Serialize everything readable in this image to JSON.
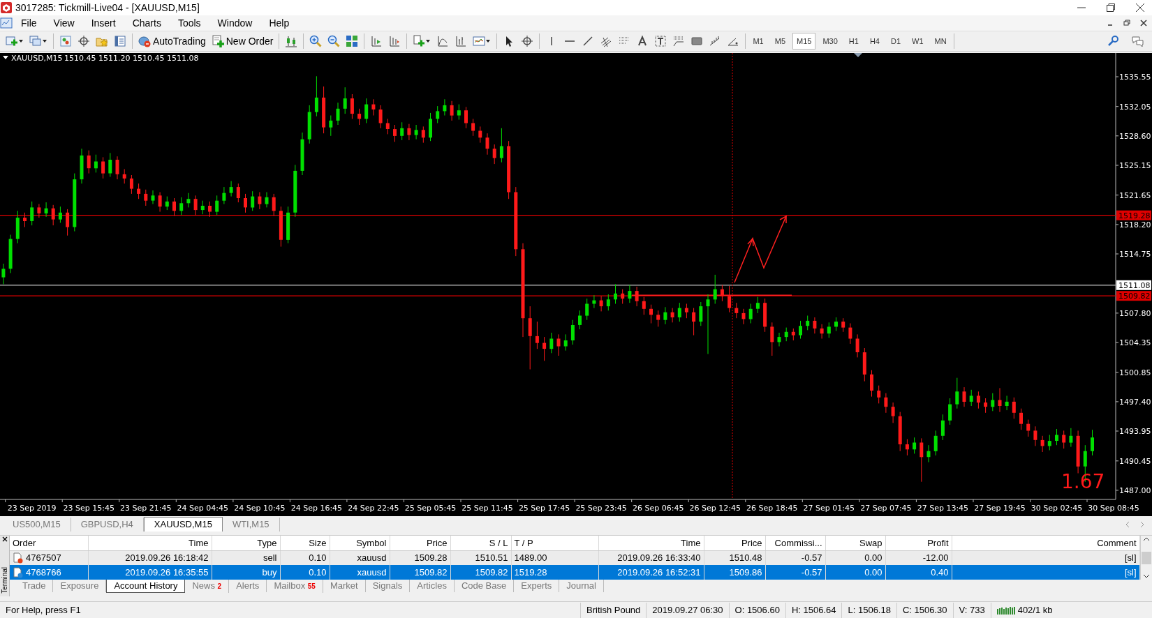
{
  "window": {
    "title": "3017285: Tickmill-Live04 - [XAUUSD,M15]"
  },
  "menu": [
    "File",
    "View",
    "Insert",
    "Charts",
    "Tools",
    "Window",
    "Help"
  ],
  "toolbar": {
    "buttons": [
      {
        "label": "AutoTrading",
        "kind": "autotrading"
      },
      {
        "label": "New Order",
        "kind": "new-order"
      }
    ],
    "timeframes": [
      {
        "label": "M1",
        "selected": false
      },
      {
        "label": "M5",
        "selected": false
      },
      {
        "label": "M15",
        "selected": true
      },
      {
        "label": "M30",
        "selected": false
      },
      {
        "label": "H1",
        "selected": false
      },
      {
        "label": "H4",
        "selected": false
      },
      {
        "label": "D1",
        "selected": false
      },
      {
        "label": "W1",
        "selected": false
      },
      {
        "label": "MN",
        "selected": false
      }
    ]
  },
  "chart": {
    "symbol": "XAUUSD,M15",
    "ohlc_readout": "1510.45 1511.20 1510.45 1511.08",
    "overlay_value": "1.67",
    "chart_data": {
      "type": "candlestick",
      "categories": [
        null,
        null,
        null,
        null,
        "23 Sep 2019",
        null,
        null,
        null,
        null,
        null,
        null,
        null,
        "23 Sep 15:45",
        null,
        null,
        null,
        null,
        null,
        null,
        null,
        "23 Sep 21:45",
        null,
        null,
        null,
        null,
        null,
        null,
        null,
        "24 Sep 04:45",
        null,
        null,
        null,
        null,
        null,
        null,
        null,
        "24 Sep 10:45",
        null,
        null,
        null,
        null,
        null,
        null,
        null,
        "24 Sep 16:45",
        null,
        null,
        null,
        null,
        null,
        null,
        null,
        "24 Sep 22:45",
        null,
        null,
        null,
        null,
        null,
        null,
        null,
        "25 Sep 05:45",
        null,
        null,
        null,
        null,
        null,
        null,
        null,
        "25 Sep 11:45",
        null,
        null,
        null,
        null,
        null,
        null,
        null,
        "25 Sep 17:45",
        null,
        null,
        null,
        null,
        null,
        null,
        null,
        "25 Sep 23:45",
        null,
        null,
        null,
        null,
        null,
        null,
        null,
        "26 Sep 06:45",
        null,
        null,
        null,
        null,
        null,
        null,
        null,
        "26 Sep 12:45",
        null,
        null,
        null,
        null,
        null,
        null,
        null,
        "26 Sep 18:45",
        null,
        null,
        null,
        null,
        null,
        null,
        null,
        "27 Sep 01:45",
        null,
        null,
        null,
        null,
        null,
        null,
        null,
        "27 Sep 07:45",
        null,
        null,
        null,
        null,
        null,
        null,
        null,
        "27 Sep 13:45",
        null,
        null,
        null,
        null,
        null,
        null,
        null,
        "27 Sep 19:45",
        null,
        null,
        null,
        null,
        null,
        null,
        null,
        "30 Sep 02:45",
        null,
        null,
        null,
        null,
        null,
        null,
        null,
        "30 Sep 08:45"
      ],
      "ref_lines": [
        {
          "axis": "y",
          "value": 1519.28,
          "label": "1519.28",
          "color": "#e00000"
        },
        {
          "axis": "y",
          "value": 1511.08,
          "label": "1511.08",
          "color": "#c0c0c0"
        },
        {
          "axis": "y",
          "value": 1509.82,
          "label": "1509.82",
          "color": "#e00000"
        }
      ],
      "ohlc": [
        [
          1512.0,
          1513.6,
          1511.2,
          1513.0
        ],
        [
          1513.0,
          1517.0,
          1512.5,
          1516.5
        ],
        [
          1516.5,
          1519.8,
          1516.0,
          1519.0
        ],
        [
          1519.0,
          1519.6,
          1517.9,
          1518.6
        ],
        [
          1518.6,
          1520.9,
          1518.1,
          1520.2
        ],
        [
          1520.2,
          1520.6,
          1519.0,
          1519.5
        ],
        [
          1519.5,
          1520.8,
          1519.1,
          1520.1
        ],
        [
          1520.1,
          1520.5,
          1518.1,
          1518.8
        ],
        [
          1518.8,
          1520.3,
          1518.4,
          1519.6
        ],
        [
          1519.6,
          1520.0,
          1516.9,
          1517.9
        ],
        [
          1517.9,
          1524.2,
          1517.4,
          1523.5
        ],
        [
          1523.5,
          1527.1,
          1523.0,
          1526.3
        ],
        [
          1526.3,
          1526.9,
          1524.2,
          1524.8
        ],
        [
          1524.8,
          1526.4,
          1524.3,
          1525.6
        ],
        [
          1525.6,
          1526.1,
          1523.6,
          1524.2
        ],
        [
          1524.2,
          1526.6,
          1523.8,
          1525.8
        ],
        [
          1525.8,
          1526.2,
          1523.5,
          1524.1
        ],
        [
          1524.1,
          1524.7,
          1523.0,
          1523.6
        ],
        [
          1523.6,
          1524.0,
          1521.8,
          1522.4
        ],
        [
          1522.4,
          1523.0,
          1521.2,
          1521.8
        ],
        [
          1521.8,
          1522.3,
          1520.4,
          1521.0
        ],
        [
          1521.0,
          1522.2,
          1520.6,
          1521.6
        ],
        [
          1521.6,
          1522.0,
          1519.7,
          1520.3
        ],
        [
          1520.3,
          1521.5,
          1519.9,
          1520.9
        ],
        [
          1520.9,
          1521.3,
          1519.2,
          1519.8
        ],
        [
          1519.8,
          1521.4,
          1519.3,
          1520.7
        ],
        [
          1520.7,
          1521.9,
          1520.2,
          1521.2
        ],
        [
          1521.2,
          1521.6,
          1519.3,
          1519.9
        ],
        [
          1519.9,
          1521.0,
          1519.4,
          1520.4
        ],
        [
          1520.4,
          1520.9,
          1519.1,
          1519.7
        ],
        [
          1519.7,
          1521.6,
          1519.3,
          1521.0
        ],
        [
          1521.0,
          1522.6,
          1520.6,
          1521.9
        ],
        [
          1521.9,
          1523.3,
          1521.5,
          1522.6
        ],
        [
          1522.6,
          1523.0,
          1520.8,
          1521.3
        ],
        [
          1521.3,
          1521.8,
          1519.6,
          1520.2
        ],
        [
          1520.2,
          1522.1,
          1519.8,
          1521.5
        ],
        [
          1521.5,
          1522.0,
          1520.0,
          1520.6
        ],
        [
          1520.6,
          1522.0,
          1520.2,
          1521.4
        ],
        [
          1521.4,
          1521.8,
          1519.2,
          1519.8
        ],
        [
          1519.8,
          1520.3,
          1515.6,
          1516.4
        ],
        [
          1516.4,
          1520.3,
          1516.0,
          1519.6
        ],
        [
          1519.6,
          1525.2,
          1519.1,
          1524.5
        ],
        [
          1524.5,
          1529.0,
          1524.0,
          1528.2
        ],
        [
          1528.2,
          1532.2,
          1527.7,
          1531.4
        ],
        [
          1531.4,
          1535.6,
          1530.9,
          1533.1
        ],
        [
          1533.1,
          1534.4,
          1528.9,
          1529.6
        ],
        [
          1529.6,
          1531.0,
          1528.6,
          1530.4
        ],
        [
          1530.4,
          1532.5,
          1529.9,
          1531.8
        ],
        [
          1531.8,
          1534.3,
          1531.2,
          1533.0
        ],
        [
          1533.0,
          1533.5,
          1530.6,
          1531.2
        ],
        [
          1531.2,
          1531.8,
          1529.9,
          1530.6
        ],
        [
          1530.6,
          1533.0,
          1530.1,
          1532.3
        ],
        [
          1532.3,
          1532.9,
          1531.0,
          1531.7
        ],
        [
          1531.7,
          1532.2,
          1529.5,
          1530.1
        ],
        [
          1530.1,
          1530.6,
          1528.8,
          1529.4
        ],
        [
          1529.4,
          1529.9,
          1527.9,
          1528.6
        ],
        [
          1528.6,
          1530.2,
          1528.1,
          1529.5
        ],
        [
          1529.5,
          1530.0,
          1528.1,
          1528.7
        ],
        [
          1528.7,
          1529.9,
          1528.2,
          1529.3
        ],
        [
          1529.3,
          1529.7,
          1527.8,
          1528.4
        ],
        [
          1528.4,
          1531.3,
          1528.0,
          1530.6
        ],
        [
          1530.6,
          1532.1,
          1530.1,
          1531.5
        ],
        [
          1531.5,
          1532.9,
          1531.0,
          1532.2
        ],
        [
          1532.2,
          1532.7,
          1530.4,
          1531.0
        ],
        [
          1531.0,
          1532.3,
          1530.5,
          1531.6
        ],
        [
          1531.6,
          1532.0,
          1529.5,
          1530.1
        ],
        [
          1530.1,
          1530.6,
          1528.6,
          1529.2
        ],
        [
          1529.2,
          1529.7,
          1527.8,
          1528.4
        ],
        [
          1528.4,
          1528.9,
          1526.4,
          1527.1
        ],
        [
          1527.1,
          1527.6,
          1525.3,
          1526.0
        ],
        [
          1526.0,
          1529.5,
          1525.5,
          1527.4
        ],
        [
          1527.4,
          1528.0,
          1521.2,
          1522.0
        ],
        [
          1522.0,
          1522.6,
          1514.5,
          1515.3
        ],
        [
          1515.3,
          1516.0,
          1505.0,
          1507.2
        ],
        [
          1507.2,
          1508.6,
          1501.2,
          1505.1
        ],
        [
          1505.1,
          1506.8,
          1503.6,
          1504.3
        ],
        [
          1504.3,
          1505.0,
          1502.2,
          1503.6
        ],
        [
          1503.6,
          1505.5,
          1503.1,
          1504.8
        ],
        [
          1504.8,
          1505.3,
          1502.8,
          1503.9
        ],
        [
          1503.9,
          1505.3,
          1503.4,
          1504.6
        ],
        [
          1504.6,
          1507.0,
          1504.1,
          1506.4
        ],
        [
          1506.4,
          1508.1,
          1505.9,
          1507.5
        ],
        [
          1507.5,
          1509.5,
          1507.0,
          1508.9
        ],
        [
          1508.9,
          1509.9,
          1508.4,
          1509.3
        ],
        [
          1509.3,
          1509.8,
          1508.0,
          1508.6
        ],
        [
          1508.6,
          1510.0,
          1508.1,
          1509.4
        ],
        [
          1509.4,
          1511.2,
          1508.9,
          1510.1
        ],
        [
          1510.1,
          1510.6,
          1508.9,
          1509.5
        ],
        [
          1509.5,
          1511.1,
          1509.0,
          1510.4
        ],
        [
          1510.4,
          1510.9,
          1508.6,
          1509.2
        ],
        [
          1509.2,
          1509.7,
          1507.6,
          1508.3
        ],
        [
          1508.3,
          1508.8,
          1506.6,
          1507.6
        ],
        [
          1507.6,
          1508.1,
          1506.2,
          1507.0
        ],
        [
          1507.0,
          1508.5,
          1506.5,
          1507.9
        ],
        [
          1507.9,
          1508.4,
          1506.7,
          1507.3
        ],
        [
          1507.3,
          1509.0,
          1506.8,
          1508.4
        ],
        [
          1508.4,
          1508.9,
          1507.2,
          1507.9
        ],
        [
          1507.9,
          1508.4,
          1505.2,
          1506.8
        ],
        [
          1506.8,
          1509.1,
          1506.3,
          1508.6
        ],
        [
          1508.6,
          1510.0,
          1503.0,
          1509.4
        ],
        [
          1509.4,
          1512.3,
          1508.9,
          1510.6
        ],
        [
          1510.6,
          1511.1,
          1509.2,
          1509.8
        ],
        [
          1509.8,
          1511.0,
          1507.9,
          1508.4
        ],
        [
          1508.4,
          1509.0,
          1507.2,
          1507.8
        ],
        [
          1507.8,
          1508.3,
          1506.5,
          1507.1
        ],
        [
          1507.1,
          1508.9,
          1506.6,
          1508.3
        ],
        [
          1508.3,
          1509.7,
          1507.8,
          1509.0
        ],
        [
          1509.0,
          1509.5,
          1505.6,
          1506.2
        ],
        [
          1506.2,
          1506.7,
          1502.8,
          1504.4
        ],
        [
          1504.4,
          1505.5,
          1503.9,
          1505.0
        ],
        [
          1505.0,
          1506.1,
          1504.5,
          1505.6
        ],
        [
          1505.6,
          1506.0,
          1504.6,
          1505.2
        ],
        [
          1505.2,
          1506.9,
          1504.8,
          1506.3
        ],
        [
          1506.3,
          1507.5,
          1505.8,
          1506.9
        ],
        [
          1506.9,
          1507.3,
          1505.4,
          1506.0
        ],
        [
          1506.0,
          1506.5,
          1504.8,
          1505.4
        ],
        [
          1505.4,
          1506.7,
          1504.9,
          1506.2
        ],
        [
          1506.2,
          1507.3,
          1505.7,
          1506.8
        ],
        [
          1506.8,
          1507.2,
          1505.6,
          1506.1
        ],
        [
          1506.1,
          1506.6,
          1504.2,
          1504.8
        ],
        [
          1504.8,
          1505.3,
          1502.6,
          1503.2
        ],
        [
          1503.2,
          1503.7,
          1499.8,
          1500.6
        ],
        [
          1500.6,
          1501.1,
          1498.0,
          1498.7
        ],
        [
          1498.7,
          1499.3,
          1497.2,
          1497.9
        ],
        [
          1497.9,
          1498.4,
          1496.1,
          1496.8
        ],
        [
          1496.8,
          1497.3,
          1494.9,
          1495.7
        ],
        [
          1495.7,
          1496.2,
          1491.6,
          1492.4
        ],
        [
          1492.4,
          1493.0,
          1491.1,
          1491.8
        ],
        [
          1491.8,
          1493.2,
          1491.3,
          1492.6
        ],
        [
          1492.6,
          1493.1,
          1488.0,
          1490.9
        ],
        [
          1490.9,
          1492.3,
          1490.3,
          1491.6
        ],
        [
          1491.6,
          1494.0,
          1491.1,
          1493.4
        ],
        [
          1493.4,
          1495.9,
          1492.9,
          1495.2
        ],
        [
          1495.2,
          1497.8,
          1494.7,
          1497.1
        ],
        [
          1497.1,
          1500.2,
          1496.6,
          1498.6
        ],
        [
          1498.6,
          1499.1,
          1496.8,
          1497.4
        ],
        [
          1497.4,
          1498.8,
          1496.9,
          1498.1
        ],
        [
          1498.1,
          1498.6,
          1496.6,
          1497.3
        ],
        [
          1497.3,
          1497.8,
          1496.1,
          1496.8
        ],
        [
          1496.8,
          1498.4,
          1496.3,
          1497.6
        ],
        [
          1497.6,
          1499.0,
          1496.2,
          1496.9
        ],
        [
          1496.9,
          1498.1,
          1496.4,
          1497.4
        ],
        [
          1497.4,
          1497.9,
          1495.4,
          1496.1
        ],
        [
          1496.1,
          1496.6,
          1494.1,
          1494.8
        ],
        [
          1494.8,
          1495.3,
          1493.3,
          1494.0
        ],
        [
          1494.0,
          1494.5,
          1492.2,
          1492.9
        ],
        [
          1492.9,
          1493.4,
          1491.5,
          1492.2
        ],
        [
          1492.2,
          1493.5,
          1491.7,
          1492.8
        ],
        [
          1492.8,
          1494.2,
          1492.3,
          1493.5
        ],
        [
          1493.5,
          1494.0,
          1491.9,
          1492.6
        ],
        [
          1492.6,
          1494.3,
          1492.1,
          1493.4
        ],
        [
          1493.4,
          1494.0,
          1489.0,
          1489.8
        ],
        [
          1489.8,
          1492.3,
          1488.0,
          1491.6
        ],
        [
          1491.6,
          1494.1,
          1491.1,
          1493.2
        ],
        null,
        null,
        null
      ],
      "ylim": [
        1485.93,
        1538.33
      ],
      "yticks": [
        {
          "value": 1535.55,
          "label": "1535.55"
        },
        {
          "value": 1532.05,
          "label": "1532.05"
        },
        {
          "value": 1528.6,
          "label": "1528.60"
        },
        {
          "value": 1525.15,
          "label": "1525.15"
        },
        {
          "value": 1521.65,
          "label": "1521.65"
        },
        {
          "value": 1518.2,
          "label": "1518.20"
        },
        {
          "value": 1514.75,
          "label": "1514.75"
        },
        {
          "value": 1507.8,
          "label": "1507.80"
        },
        {
          "value": 1504.35,
          "label": "1504.35"
        },
        {
          "value": 1500.85,
          "label": "1500.85"
        },
        {
          "value": 1497.4,
          "label": "1497.40"
        },
        {
          "value": 1493.95,
          "label": "1493.95"
        },
        {
          "value": 1490.45,
          "label": "1490.45"
        },
        {
          "value": 1487,
          "label": "1487.00"
        }
      ]
    }
  },
  "chart_tabs": [
    {
      "label": "US500,M15",
      "selected": false
    },
    {
      "label": "GBPUSD,H4",
      "selected": false
    },
    {
      "label": "XAUUSD,M15",
      "selected": true
    },
    {
      "label": "WTI,M15",
      "selected": false
    }
  ],
  "terminal": {
    "title": "Terminal",
    "columns": [
      "Order",
      "Time",
      "Type",
      "Size",
      "Symbol",
      "Price",
      "S / L",
      "T / P",
      "Time",
      "Price",
      "Commissi...",
      "Swap",
      "Profit",
      "Comment"
    ],
    "rows": [
      {
        "kind": "sell",
        "selected": false,
        "cells": [
          "4767507",
          "2019.09.26 16:18:42",
          "sell",
          "0.10",
          "xauusd",
          "1509.28",
          "1510.51",
          "1489.00",
          "2019.09.26 16:33:40",
          "1510.48",
          "-0.57",
          "0.00",
          "-12.00",
          "[sl]"
        ]
      },
      {
        "kind": "buy",
        "selected": true,
        "cells": [
          "4768766",
          "2019.09.26 16:35:55",
          "buy",
          "0.10",
          "xauusd",
          "1509.82",
          "1509.82",
          "1519.28",
          "2019.09.26 16:52:31",
          "1509.86",
          "-0.57",
          "0.00",
          "0.40",
          "[sl]"
        ]
      }
    ],
    "tabs": [
      {
        "label": "Trade",
        "selected": false
      },
      {
        "label": "Exposure",
        "selected": false
      },
      {
        "label": "Account History",
        "selected": true
      },
      {
        "label": "News",
        "count": "2",
        "selected": false
      },
      {
        "label": "Alerts",
        "selected": false
      },
      {
        "label": "Mailbox",
        "count": "55",
        "selected": false
      },
      {
        "label": "Market",
        "selected": false
      },
      {
        "label": "Signals",
        "selected": false
      },
      {
        "label": "Articles",
        "selected": false
      },
      {
        "label": "Code Base",
        "selected": false
      },
      {
        "label": "Experts",
        "selected": false
      },
      {
        "label": "Journal",
        "selected": false
      }
    ]
  },
  "status_bar": [
    {
      "kind": "text",
      "text": "For Help, press F1"
    },
    {
      "kind": "text",
      "text": "British Pound"
    },
    {
      "kind": "text",
      "text": "2019.09.27 06:30"
    },
    {
      "kind": "text",
      "text": "O: 1506.60"
    },
    {
      "kind": "text",
      "text": "H: 1506.64"
    },
    {
      "kind": "text",
      "text": "L: 1506.18"
    },
    {
      "kind": "text",
      "text": "C: 1506.30"
    },
    {
      "kind": "text",
      "text": "V: 733"
    },
    {
      "kind": "connection",
      "text": "402/1 kb"
    }
  ]
}
